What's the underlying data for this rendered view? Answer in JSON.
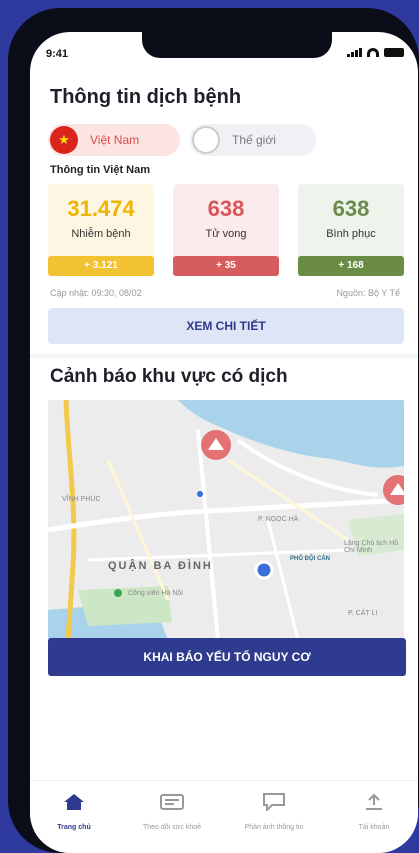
{
  "status_bar": {
    "time": "9:41"
  },
  "page_title": "Thông tin dịch bệnh",
  "scope_toggle": {
    "vietnam_label": "Việt Nam",
    "world_label": "Thế giới"
  },
  "stats_section": {
    "subtitle": "Thông tin Việt Nam",
    "cards": [
      {
        "value": "31.474",
        "label": "Nhiễm bệnh",
        "delta": "+ 3.121",
        "color": "#f3c233"
      },
      {
        "value": "638",
        "label": "Tử vong",
        "delta": "+ 35",
        "color": "#d65c5e"
      },
      {
        "value": "638",
        "label": "Bình phục",
        "delta": "+ 168",
        "color": "#6b8c44"
      }
    ],
    "updated_at": "Cập nhật: 09:30, 08/02",
    "source": "Nguồn: Bộ Y Tế",
    "detail_button": "XEM CHI TIẾT"
  },
  "warning_section": {
    "title": "Cảnh báo khu vực có dịch",
    "map_labels": {
      "district": "QUẬN BA ĐÌNH",
      "ward_1": "P. NGỌC HÀ",
      "ward_2": "VĨNH PHÚC",
      "ward_3": "P. CÁT LI",
      "place_1": "Công viên Hà Nội",
      "place_2": "Lăng Chủ tịch Hồ Chí Minh",
      "road_1": "PHỐ ĐỘI CẤN"
    },
    "declare_button": "KHAI BÁO YẾU TỐ NGUY CƠ"
  },
  "tab_bar": [
    {
      "label": "Trang chủ",
      "icon": "home-icon",
      "active": true
    },
    {
      "label": "Theo dõi sức khoẻ",
      "icon": "health-card-icon",
      "active": false
    },
    {
      "label": "Phản ánh thông tin",
      "icon": "feedback-icon",
      "active": false
    },
    {
      "label": "Tài khoản",
      "icon": "account-icon",
      "active": false
    }
  ],
  "colors": {
    "brand": "#2f3b8e",
    "background": "#2e3a9e"
  }
}
